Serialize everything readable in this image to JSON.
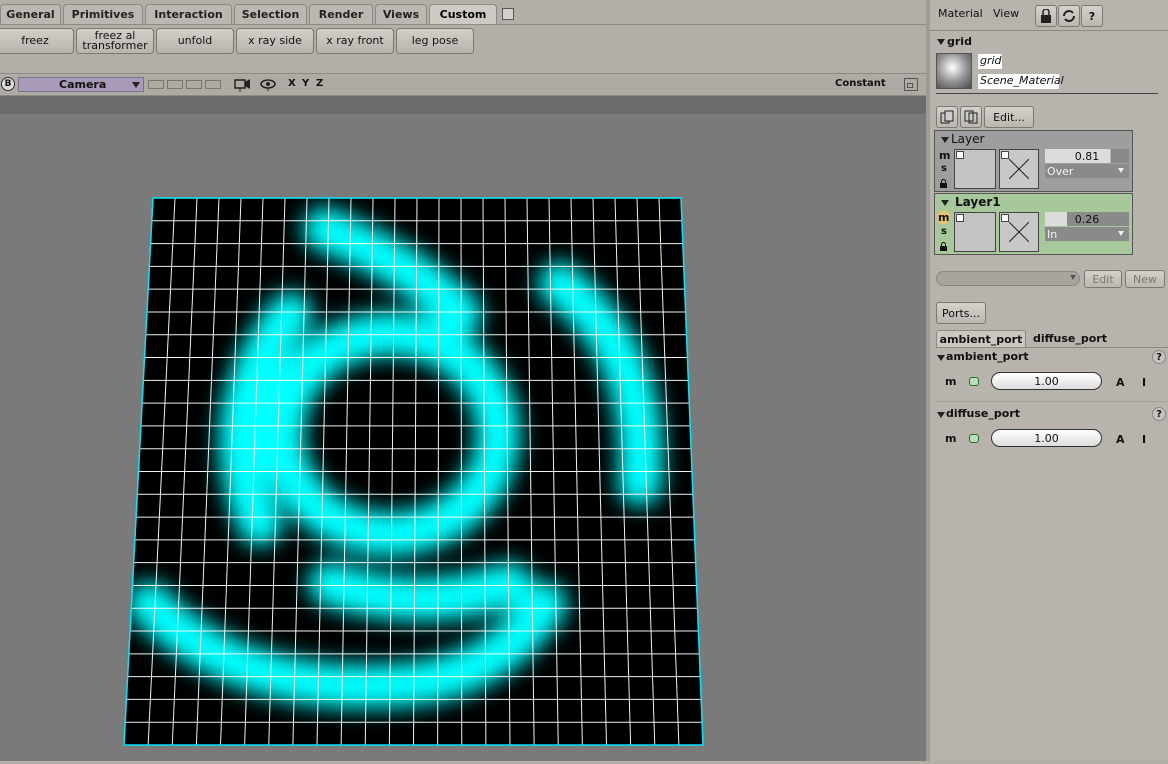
{
  "shelf": {
    "tabs": [
      "General",
      "Primitives",
      "Interaction",
      "Selection",
      "Render",
      "Views",
      "Custom"
    ],
    "active_tab": "Custom",
    "buttons": [
      "freez",
      "freez al\ntransformer",
      "unfold",
      "x ray side",
      "x ray front",
      "leg pose"
    ]
  },
  "viewport": {
    "mode_letter": "B",
    "camera_label": "Camera",
    "axes": [
      "X",
      "Y",
      "Z"
    ],
    "shading_label": "Constant",
    "colors": {
      "glow": "#00ffff",
      "background": "#000000",
      "wire": "#ffffff",
      "border": "#00e5ff"
    }
  },
  "panel": {
    "menu": [
      "Material",
      "View"
    ],
    "material_title": "grid",
    "material_name": "grid",
    "material_type": "Scene_Material",
    "edit_label": "Edit...",
    "layers": [
      {
        "name": "Layer",
        "flags": [
          "m",
          "s"
        ],
        "value": "0.81",
        "mode": "Over"
      },
      {
        "name": "Layer1",
        "flags": [
          "m",
          "s"
        ],
        "value": "0.26",
        "mode": "In"
      }
    ],
    "edit2_label": "Edit",
    "new_label": "New",
    "ports_label": "Ports...",
    "port_tabs": [
      "ambient_port",
      "diffuse_port"
    ],
    "ports": [
      {
        "name": "ambient_port",
        "flag": "m",
        "value": "1.00",
        "a": "A",
        "i": "I",
        "help": "?"
      },
      {
        "name": "diffuse_port",
        "flag": "m",
        "value": "1.00",
        "a": "A",
        "i": "I",
        "help": "?"
      }
    ]
  }
}
